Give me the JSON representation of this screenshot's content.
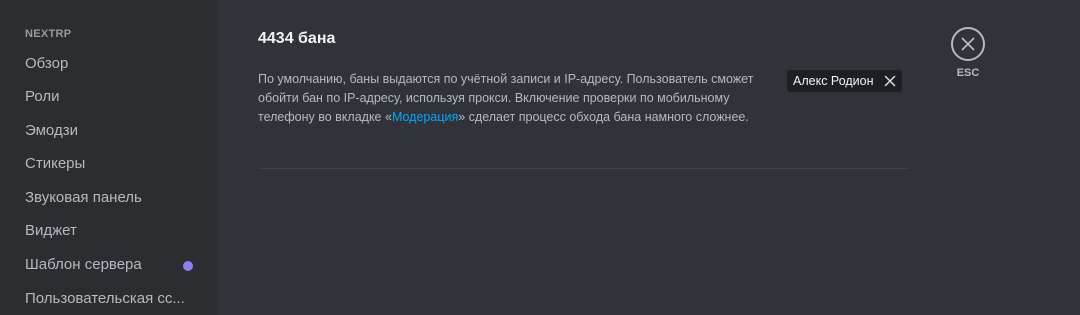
{
  "sidebar": {
    "header": "NEXTRP",
    "items": [
      {
        "label": "Обзор"
      },
      {
        "label": "Роли"
      },
      {
        "label": "Эмодзи"
      },
      {
        "label": "Стикеры"
      },
      {
        "label": "Звуковая панель"
      },
      {
        "label": "Виджет"
      },
      {
        "label": "Шаблон сервера",
        "badge": "purple-dot"
      },
      {
        "label": "Пользовательская сс..."
      }
    ]
  },
  "main": {
    "title": "4434 бана",
    "description_before": "По умолчанию, баны выдаются по учётной записи и IP-адресу. Пользователь сможет обойти бан по IP-адресу, используя прокси. Включение проверки по мобильному телефону во вкладке «",
    "description_link": "Модерация",
    "description_after": "» сделает процесс обхода бана намного сложнее.",
    "user_tag": {
      "name": "Алекс Родион",
      "remove_icon": "close-icon"
    }
  },
  "close": {
    "icon": "close-icon",
    "label": "ESC"
  },
  "colors": {
    "background": "#313338",
    "sidebar": "#2b2d31",
    "link": "#00a8fc",
    "badge": "#8b7ff6"
  }
}
